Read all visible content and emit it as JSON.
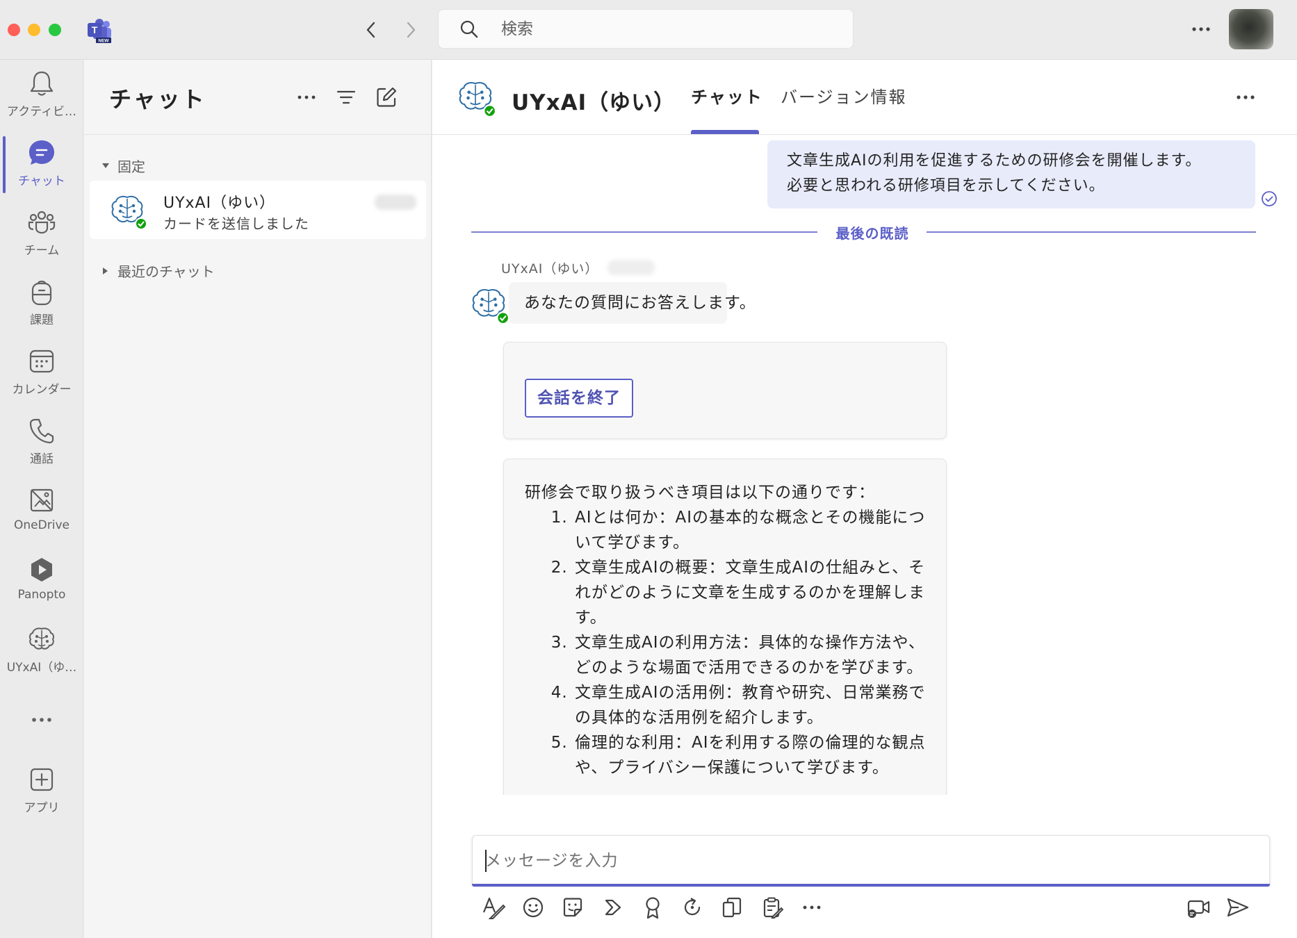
{
  "search": {
    "placeholder": "検索"
  },
  "rail": {
    "items": [
      {
        "label": "アクティビ…",
        "icon": "bell-icon"
      },
      {
        "label": "チャット",
        "icon": "chat-icon",
        "active": true
      },
      {
        "label": "チーム",
        "icon": "teams-icon"
      },
      {
        "label": "課題",
        "icon": "backpack-icon"
      },
      {
        "label": "カレンダー",
        "icon": "calendar-icon"
      },
      {
        "label": "通話",
        "icon": "phone-icon"
      },
      {
        "label": "OneDrive",
        "icon": "onedrive-icon"
      },
      {
        "label": "Panopto",
        "icon": "panopto-icon"
      },
      {
        "label": "UYxAI（ゆ…",
        "icon": "brain-icon"
      }
    ],
    "apps_label": "アプリ"
  },
  "chatlist": {
    "title": "チャット",
    "pinned_label": "固定",
    "recent_label": "最近のチャット",
    "items": [
      {
        "name": "UYxAI（ゆい）",
        "preview": "カードを送信しました"
      }
    ]
  },
  "main": {
    "title": "UYxAI（ゆい）",
    "tabs": [
      {
        "label": "チャット",
        "active": true
      },
      {
        "label": "バージョン情報",
        "active": false
      }
    ],
    "user_message": [
      "文章生成AIの利用を促進するための研修会を開催します。",
      "必要と思われる研修項目を示してください。"
    ],
    "last_read_label": "最後の既読",
    "bot_sender": "UYxAI（ゆい）",
    "bot_message": "あなたの質問にお答えします。",
    "end_button": "会話を終了",
    "answer_intro": "研修会で取り扱うべき項目は以下の通りです：",
    "answer_items": [
      "AIとは何か：AIの基本的な概念とその機能について学びます。",
      "文章生成AIの概要：文章生成AIの仕組みと、それがどのように文章を生成するのかを理解します。",
      "文章生成AIの利用方法：具体的な操作方法や、どのような場面で活用できるのかを学びます。",
      "文章生成AIの活用例：教育や研究、日常業務での具体的な活用例を紹介します。",
      "倫理的な利用：AIを利用する際の倫理的な観点や、プライバシー保護について学びます。"
    ],
    "compose_placeholder": "メッセージを入力"
  },
  "colors": {
    "accent": "#5b5fc7",
    "user_bubble": "#e8ebfa",
    "presence": "#13a10e"
  }
}
